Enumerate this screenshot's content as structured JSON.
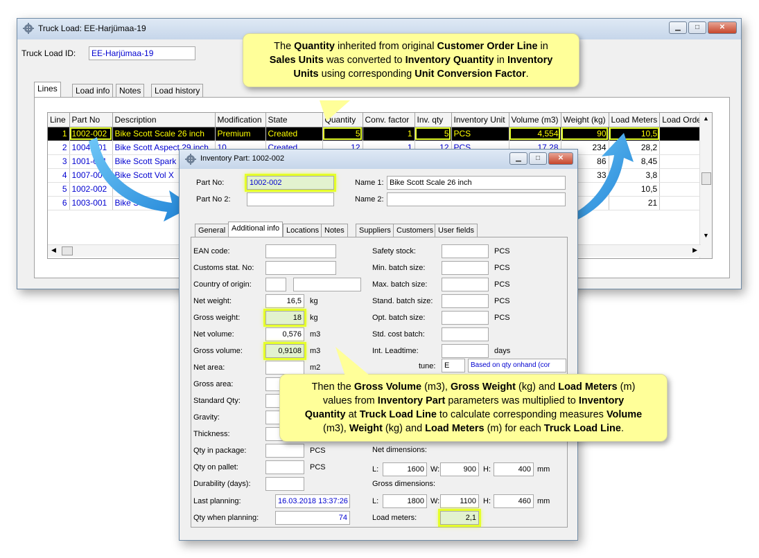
{
  "truck_window": {
    "title": "Truck Load: EE-Harjümaa-19",
    "id_label": "Truck Load ID:",
    "id_value": "EE-Harjümaa-19",
    "tabs": [
      "Lines",
      "Load info",
      "Notes",
      "Load history"
    ],
    "columns": [
      "Line",
      "Part No",
      "Description",
      "Modification",
      "State",
      "Quantity",
      "Conv. factor",
      "Inv. qty",
      "Inventory Unit",
      "Volume (m3)",
      "Weight (kg)",
      "Load Meters",
      "Load Order"
    ],
    "rows": [
      [
        "1",
        "1002-002",
        "Bike Scott Scale 26 inch",
        "Premium",
        "Created",
        "5",
        "1",
        "5",
        "PCS",
        "4,554",
        "90",
        "10,5",
        ""
      ],
      [
        "2",
        "1004-001",
        "Bike Scott Aspect 29 inch",
        "10",
        "Created",
        "12",
        "1",
        "12",
        "PCS",
        "17,28",
        "234",
        "28,2",
        ""
      ],
      [
        "3",
        "1001-001",
        "Bike Scott Spark 2",
        "",
        "",
        "",
        "",
        "",
        "",
        "",
        "86",
        "8,45",
        ""
      ],
      [
        "4",
        "1007-00",
        "Bike Scott Vol X",
        "",
        "",
        "",
        "",
        "",
        "",
        "",
        "33",
        "3,8",
        ""
      ],
      [
        "5",
        "1002-002",
        "",
        "",
        "",
        "",
        "",
        "",
        "",
        "",
        "9",
        "10,5",
        ""
      ],
      [
        "6",
        "1003-001",
        "Bike Sc",
        "",
        "",
        "",
        "",
        "",
        "",
        "",
        "",
        "21",
        ""
      ]
    ]
  },
  "part_window": {
    "title": "Inventory Part: 1002-002",
    "part_no_label": "Part No:",
    "part_no_value": "1002-002",
    "part_no2_label": "Part No 2:",
    "name1_label": "Name 1:",
    "name1_value": "Bike Scott Scale 26 inch",
    "name2_label": "Name 2:",
    "tabs": [
      "General",
      "Additional info",
      "Locations",
      "Notes",
      "Suppliers",
      "Customers",
      "User fields"
    ],
    "left_fields": [
      {
        "label": "EAN code:",
        "value": "",
        "unit": ""
      },
      {
        "label": "Customs stat. No:",
        "value": "",
        "unit": ""
      },
      {
        "label": "Country of origin:",
        "value": "",
        "unit": ""
      },
      {
        "label": "Net weight:",
        "value": "16,5",
        "unit": "kg"
      },
      {
        "label": "Gross weight:",
        "value": "18",
        "unit": "kg"
      },
      {
        "label": "Net volume:",
        "value": "0,576",
        "unit": "m3"
      },
      {
        "label": "Gross volume:",
        "value": "0,9108",
        "unit": "m3"
      },
      {
        "label": "Net area:",
        "value": "",
        "unit": "m2"
      },
      {
        "label": "Gross area:",
        "value": "",
        "unit": ""
      },
      {
        "label": "Standard Qty:",
        "value": "",
        "unit": ""
      },
      {
        "label": "Gravity:",
        "value": "",
        "unit": ""
      },
      {
        "label": "Thickness:",
        "value": "",
        "unit": ""
      },
      {
        "label": "Qty in package:",
        "value": "",
        "unit": "PCS"
      },
      {
        "label": "Qty on pallet:",
        "value": "",
        "unit": "PCS"
      },
      {
        "label": "Durability (days):",
        "value": "",
        "unit": ""
      }
    ],
    "last_planning_label": "Last planning:",
    "last_planning_value": "16.03.2018 13:37:26",
    "qty_when_planning_label": "Qty when planning:",
    "qty_when_planning_value": "74",
    "right_fields": [
      {
        "label": "Safety stock:",
        "unit": "PCS"
      },
      {
        "label": "Min. batch size:",
        "unit": "PCS"
      },
      {
        "label": "Max. batch size:",
        "unit": "PCS"
      },
      {
        "label": "Stand. batch size:",
        "unit": "PCS"
      },
      {
        "label": "Opt. batch size:",
        "unit": "PCS"
      },
      {
        "label": "Std. cost batch:",
        "unit": ""
      },
      {
        "label": "Int. Leadtime:",
        "unit": "days"
      }
    ],
    "valuation_partial_label": "tune:",
    "valuation_code": "E",
    "valuation_text": "Based on qty onhand (cor",
    "net_dimensions_label": "Net dimensions:",
    "net_l": "1600",
    "net_w": "900",
    "net_h": "400",
    "gross_dimensions_label": "Gross dimensions:",
    "gross_l": "1800",
    "gross_w": "1100",
    "gross_h": "460",
    "dim_l": "L:",
    "dim_w": "W:",
    "dim_h": "H:",
    "dim_unit": "mm",
    "load_meters_label": "Load meters:",
    "load_meters_value": "2,1"
  },
  "callout_top": {
    "p1": "The ",
    "b1": "Quantity",
    "p2": " inherited from original ",
    "b2": "Customer Order Line",
    "p3": " in ",
    "b3": "Sales Units",
    "p4": " was converted to ",
    "b4": "Inventory Quantity",
    "p5": " in ",
    "b5": "Inventory",
    "b6": "Units",
    "p6": " using corresponding ",
    "b7": "Unit Conversion Factor",
    "p7": "."
  },
  "callout_bottom": {
    "p1": "Then the ",
    "b1": "Gross Volume",
    "p2": " (m3), ",
    "b2": "Gross Weight",
    "p3": " (kg) and ",
    "b3": "Load Meters",
    "p4": " (m)",
    "p5": "values from ",
    "b4": "Inventory Part",
    "p6": " parameters was multiplied to ",
    "b5": "Inventory",
    "b6": "Quantity",
    "p7": " at ",
    "b7": "Truck Load Line",
    "p8": " to calculate corresponding measures ",
    "b8": "Volume",
    "p9": "(m3), ",
    "b9": "Weight",
    "p10": " (kg) and ",
    "b10": "Load Meters",
    "p11": " (m) for each ",
    "b11": "Truck Load Line",
    "p12": "."
  },
  "colors": {
    "highlight": "#e5ff2a",
    "callout": "#ffff99",
    "arrow": "#2b9ee6",
    "link_text": "#0000d0"
  }
}
